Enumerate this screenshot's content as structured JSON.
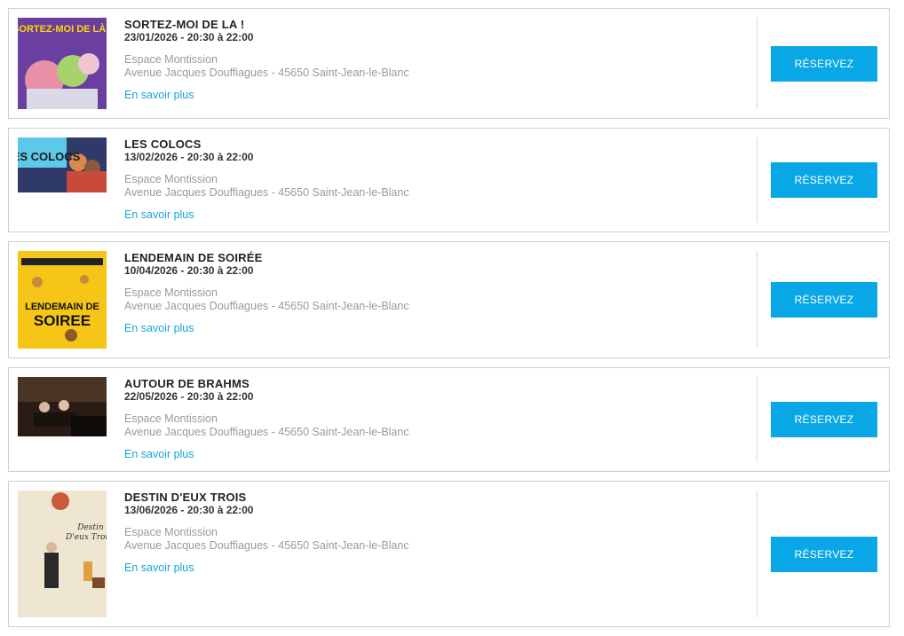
{
  "events": [
    {
      "title": "SORTEZ-MOI DE LA !",
      "datetime": "23/01/2026 - 20:30 à 22:00",
      "venue": "Espace Montission",
      "address": "Avenue Jacques Douffiagues - 45650 Saint-Jean-le-Blanc",
      "more_label": "En savoir plus",
      "button_label": "RÉSERVEZ",
      "poster_text": "SORTEZ-MOI DE LÀ !"
    },
    {
      "title": "LES COLOCS",
      "datetime": "13/02/2026 - 20:30 à 22:00",
      "venue": "Espace Montission",
      "address": "Avenue Jacques Douffiagues - 45650 Saint-Jean-le-Blanc",
      "more_label": "En savoir plus",
      "button_label": "RÉSERVEZ",
      "poster_text": "LES COLOCS"
    },
    {
      "title": "LENDEMAIN DE SOIRÉE",
      "datetime": "10/04/2026 - 20:30 à 22:00",
      "venue": "Espace Montission",
      "address": "Avenue Jacques Douffiagues - 45650 Saint-Jean-le-Blanc",
      "more_label": "En savoir plus",
      "button_label": "RÉSERVEZ",
      "poster_text": "LENDEMAIN DE SOIREE"
    },
    {
      "title": "AUTOUR DE BRAHMS",
      "datetime": "22/05/2026 - 20:30 à 22:00",
      "venue": "Espace Montission",
      "address": "Avenue Jacques Douffiagues - 45650 Saint-Jean-le-Blanc",
      "more_label": "En savoir plus",
      "button_label": "RÉSERVEZ",
      "poster_text": ""
    },
    {
      "title": "DESTIN D'EUX TROIS",
      "datetime": "13/06/2026 - 20:30 à 22:00",
      "venue": "Espace Montission",
      "address": "Avenue Jacques Douffiagues - 45650 Saint-Jean-le-Blanc",
      "more_label": "En savoir plus",
      "button_label": "RÉSERVEZ",
      "poster_text": "Destin D'eux Trois"
    }
  ],
  "colors": {
    "accent": "#0aa7e6",
    "link": "#17a4dc",
    "muted": "#9a9a9a",
    "border": "#cfcfcf"
  }
}
